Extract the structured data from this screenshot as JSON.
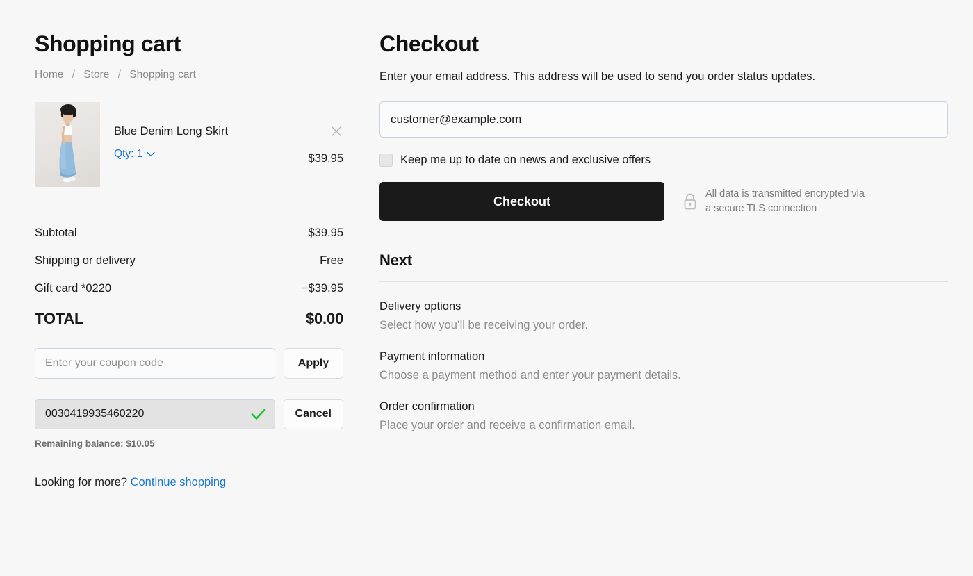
{
  "cart": {
    "title": "Shopping cart",
    "breadcrumb": [
      {
        "label": "Home"
      },
      {
        "label": "Store"
      },
      {
        "label": "Shopping cart"
      }
    ],
    "breadcrumb_separator": "/",
    "item": {
      "name": "Blue Denim Long Skirt",
      "qty_label": "Qty: 1",
      "price": "$39.95",
      "remove_icon": "close-icon",
      "qty_chevron_icon": "chevron-down-icon",
      "thumbnail_alt": "Model wearing white crop top and blue denim long skirt"
    },
    "totals": [
      {
        "label": "Subtotal",
        "value": "$39.95"
      },
      {
        "label": "Shipping or delivery",
        "value": "Free"
      },
      {
        "label": "Gift card *0220",
        "value": "−$39.95"
      }
    ],
    "grand_total": {
      "label": "TOTAL",
      "value": "$0.00"
    },
    "coupon": {
      "placeholder": "Enter your coupon code",
      "value": "",
      "apply_label": "Apply"
    },
    "giftcard": {
      "value": "0030419935460220",
      "cancel_label": "Cancel",
      "valid_icon": "checkmark-icon",
      "balance_note": "Remaining balance: $10.05"
    },
    "footer": {
      "prompt": "Looking for more?",
      "link_label": "Continue shopping"
    }
  },
  "checkout": {
    "title": "Checkout",
    "description": "Enter your email address. This address will be used to send you order status updates.",
    "email": {
      "value": "customer@example.com",
      "placeholder": "Email address"
    },
    "newsletter": {
      "label": "Keep me up to date on news and exclusive offers",
      "checked": false
    },
    "submit_label": "Checkout",
    "security_note": {
      "line1": "All data is transmitted encrypted via",
      "line2": "a secure TLS connection",
      "icon": "lock-icon"
    },
    "next": {
      "title": "Next",
      "steps": [
        {
          "title": "Delivery options",
          "desc": "Select how you’ll be receiving your order."
        },
        {
          "title": "Payment information",
          "desc": "Choose a payment method and enter your payment details."
        },
        {
          "title": "Order confirmation",
          "desc": "Place your order and receive a confirmation email."
        }
      ]
    }
  },
  "colors": {
    "page_bg": "#f7f7f7",
    "link": "#1877d2",
    "primary_button": "#1a1a1a",
    "success": "#22c32a",
    "muted_text": "#8d8d8d",
    "border": "#e3e3e3"
  }
}
